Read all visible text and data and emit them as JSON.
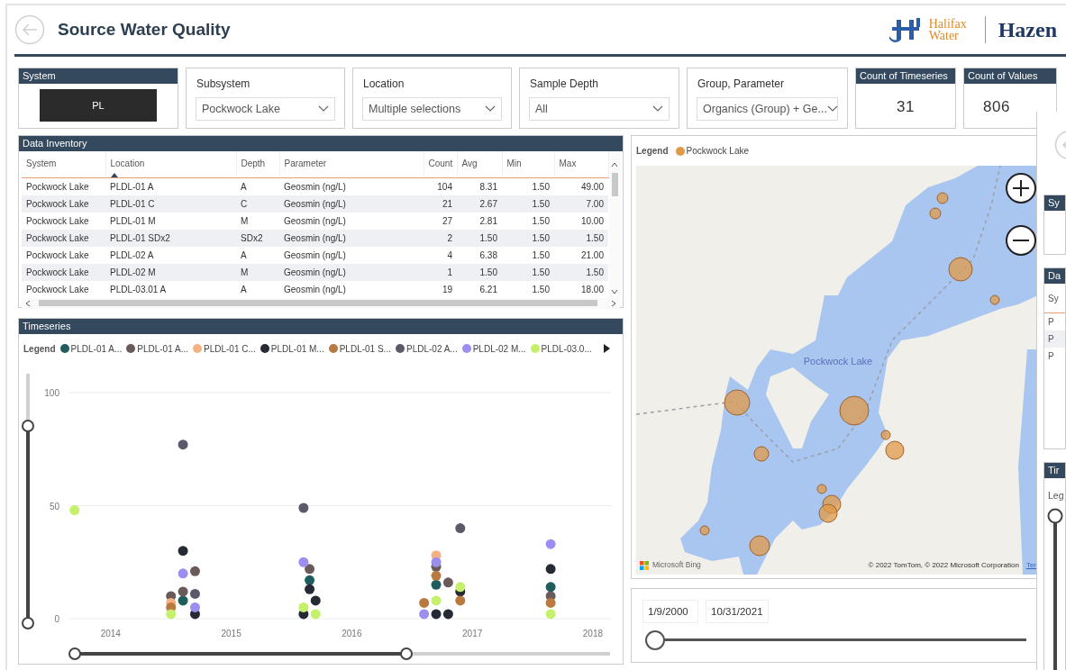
{
  "header": {
    "title": "Source Water Quality",
    "logo_line1": "Halifax",
    "logo_line2": "Water",
    "partner": "Hazen"
  },
  "filters": {
    "system": {
      "label": "System",
      "options": [
        {
          "label": "PL",
          "selected": true
        }
      ]
    },
    "dropdowns": [
      {
        "label": "Subsystem",
        "value": "Pockwock Lake"
      },
      {
        "label": "Location",
        "value": "Multiple selections"
      },
      {
        "label": "Sample Depth",
        "value": "All"
      },
      {
        "label": "Group, Parameter",
        "value": "Organics (Group) + Ge..."
      }
    ],
    "cards": [
      {
        "label": "Count of Timeseries",
        "value": "31"
      },
      {
        "label": "Count of Values",
        "value": "806"
      }
    ]
  },
  "data_inventory": {
    "title": "Data Inventory",
    "columns": [
      {
        "label": "System",
        "sorted": false
      },
      {
        "label": "Location",
        "sorted": true
      },
      {
        "label": "Depth",
        "sorted": false
      },
      {
        "label": "Parameter",
        "sorted": false
      },
      {
        "label": "Count",
        "sorted": false
      },
      {
        "label": "Avg",
        "sorted": false
      },
      {
        "label": "Min",
        "sorted": false
      },
      {
        "label": "Max",
        "sorted": false
      }
    ],
    "rows": [
      [
        "Pockwock Lake",
        "PLDL-01 A",
        "A",
        "Geosmin (ng/L)",
        "104",
        "8.31",
        "1.50",
        "49.00"
      ],
      [
        "Pockwock Lake",
        "PLDL-01 C",
        "C",
        "Geosmin (ng/L)",
        "21",
        "2.67",
        "1.50",
        "7.00"
      ],
      [
        "Pockwock Lake",
        "PLDL-01 M",
        "M",
        "Geosmin (ng/L)",
        "27",
        "2.81",
        "1.50",
        "10.00"
      ],
      [
        "Pockwock Lake",
        "PLDL-01 SDx2",
        "SDx2",
        "Geosmin (ng/L)",
        "2",
        "1.50",
        "1.50",
        "1.50"
      ],
      [
        "Pockwock Lake",
        "PLDL-02 A",
        "A",
        "Geosmin (ng/L)",
        "4",
        "6.38",
        "1.50",
        "21.00"
      ],
      [
        "Pockwock Lake",
        "PLDL-02 M",
        "M",
        "Geosmin (ng/L)",
        "1",
        "1.50",
        "1.50",
        "1.50"
      ],
      [
        "Pockwock Lake",
        "PLDL-03.01 A",
        "A",
        "Geosmin (ng/L)",
        "19",
        "6.21",
        "1.50",
        "18.00"
      ]
    ]
  },
  "timeseries": {
    "title": "Timeseries",
    "legend_label": "Legend",
    "y_slider": {
      "handles": [
        {
          "level": 0.79
        },
        {
          "level": 0
        }
      ]
    },
    "x_slider": {
      "handles": [
        {
          "level": 0
        },
        {
          "level": 0.62
        }
      ]
    },
    "chart_data": {
      "type": "scatter",
      "x": [
        2013.7,
        2014.5,
        2014.6,
        2014.7,
        2015.6,
        2015.65,
        2015.7,
        2016.6,
        2016.7,
        2016.8,
        2016.9,
        2017.65
      ],
      "series": [
        {
          "name": "PLDL-01 A...",
          "color": "#1f5c5c",
          "values": [
            null,
            null,
            8,
            null,
            null,
            17,
            null,
            null,
            15,
            null,
            null,
            14
          ]
        },
        {
          "name": "PLDL-01 A...",
          "color": "#6b5a5a",
          "values": [
            null,
            10,
            12,
            21,
            null,
            22,
            null,
            null,
            23,
            16,
            null,
            10
          ]
        },
        {
          "name": "PLDL-01 C...",
          "color": "#f4b183",
          "values": [
            null,
            7,
            null,
            null,
            null,
            null,
            null,
            null,
            28,
            null,
            null,
            null
          ]
        },
        {
          "name": "PLDL-01 M...",
          "color": "#252a35",
          "values": [
            null,
            null,
            30,
            2,
            2,
            13,
            8,
            null,
            2,
            2,
            12,
            22
          ]
        },
        {
          "name": "PLDL-01 S...",
          "color": "#b87a40",
          "values": [
            null,
            5,
            null,
            null,
            null,
            null,
            null,
            7,
            19,
            null,
            8,
            7
          ]
        },
        {
          "name": "PLDL-02 A...",
          "color": "#5a5a6a",
          "values": [
            null,
            null,
            77,
            11,
            49,
            null,
            null,
            null,
            null,
            null,
            40,
            null
          ]
        },
        {
          "name": "PLDL-02 M...",
          "color": "#9b8ef0",
          "values": [
            null,
            null,
            20,
            5,
            25,
            null,
            null,
            2,
            25,
            null,
            null,
            33
          ]
        },
        {
          "name": "PLDL-03.0...",
          "color": "#c5f06a",
          "values": [
            48,
            2,
            null,
            null,
            5,
            null,
            2,
            null,
            8,
            null,
            14,
            2
          ]
        }
      ],
      "xlim": [
        2013.65,
        2018.15
      ],
      "ylim": [
        0,
        100
      ],
      "xticks": [
        2014,
        2015,
        2016,
        2017,
        2018
      ],
      "yticks": [
        0,
        50,
        100
      ]
    }
  },
  "map": {
    "legend_label": "Legend",
    "legend": [
      {
        "label": "Pockwock Lake",
        "color": "#e09a48"
      }
    ],
    "lake_label": "Pockwock Lake",
    "credit": "Microsoft Bing",
    "attribution": "© 2022 TomTom, © 2022 Microsoft Corporation",
    "terms": "Ter"
  },
  "date_slicer": {
    "start": "1/9/2000",
    "end": "10/31/2021",
    "handles": [
      {
        "level": 0
      }
    ]
  },
  "overlay_window": {
    "system_title": "Sy",
    "inventory_title": "Da",
    "inventory_column": "Sy",
    "inventory_rows": [
      "P",
      "P",
      "P"
    ],
    "timeseries_title": "Tir",
    "legend_label": "Leg"
  }
}
